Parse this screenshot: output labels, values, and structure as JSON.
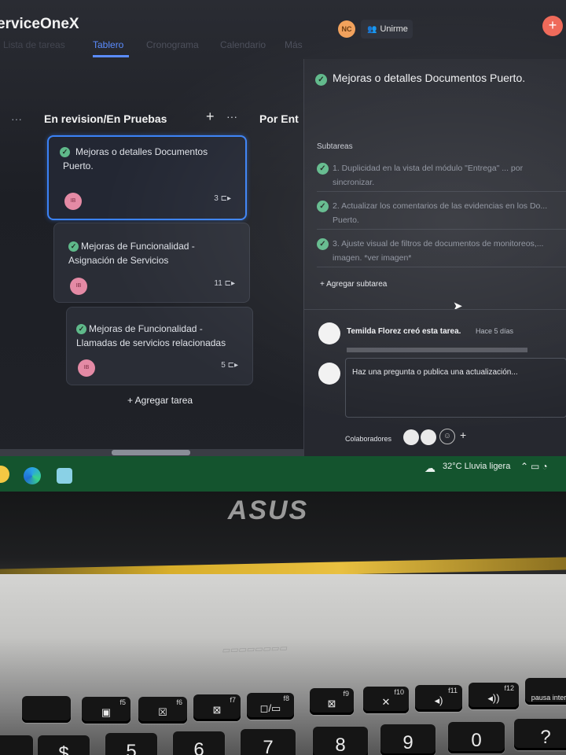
{
  "app": {
    "title": "erviceOneX",
    "tabs": [
      {
        "label": "Lista de tareas"
      },
      {
        "label": "Tablero"
      },
      {
        "label": "Cronograma"
      },
      {
        "label": "Calendario"
      },
      {
        "label": "Más"
      }
    ],
    "user_initials": "NC",
    "join_label": "Unirme"
  },
  "board": {
    "columns": [
      {
        "title": "En revision/En Pruebas"
      },
      {
        "title": "Por Ent"
      }
    ],
    "cards": [
      {
        "title": "Mejoras o detalles Documentos Puerto.",
        "count": "3",
        "avatar": "IB"
      },
      {
        "title": "Mejoras de Funcionalidad - Asignación de Servicios",
        "count": "11",
        "avatar": "IB"
      },
      {
        "title": "Mejoras de Funcionalidad - Llamadas de servicios relacionadas",
        "count": "5",
        "avatar": "IB"
      }
    ],
    "add_task": "+ Agregar tarea"
  },
  "detail": {
    "title": "Mejoras o detalles Documentos Puerto.",
    "subtasks_label": "Subtareas",
    "subtasks": [
      {
        "text": "1. Duplicidad en la vista del módulo \"Entrega\" ... por sincronizar."
      },
      {
        "text": "2. Actualizar los comentarios de las evidencias en los Do...\nPuerto."
      },
      {
        "text": "3. Ajuste visual de filtros de documentos de monitoreos,...\nimagen. *ver imagen*"
      }
    ],
    "add_subtask": "+ Agregar subtarea",
    "activity": {
      "text": "Temilda Florez creó esta tarea.",
      "time": "Hace 5 días"
    },
    "comment_placeholder": "Haz una pregunta o publica una actualización...",
    "collaborators_label": "Colaboradores"
  },
  "taskbar": {
    "weather": "32°C  Lluvia ligera"
  },
  "laptop": {
    "brand": "ASUS",
    "keys": [
      {
        "sub": "f5"
      },
      {
        "sub": "f6"
      },
      {
        "sub": "f7"
      },
      {
        "sub": "f8"
      },
      {
        "sub": "f9"
      },
      {
        "sub": "f10"
      },
      {
        "sub": "f11"
      },
      {
        "sub": "f12"
      },
      {
        "label": "pausa inter"
      }
    ],
    "number_keys": [
      "5",
      "6",
      "7",
      "8",
      "9",
      "0"
    ]
  },
  "colors": {
    "accent": "#5b8cff",
    "check": "#5fb98a",
    "taskbar": "#14542e",
    "card_selected_border": "#3b82f6"
  }
}
